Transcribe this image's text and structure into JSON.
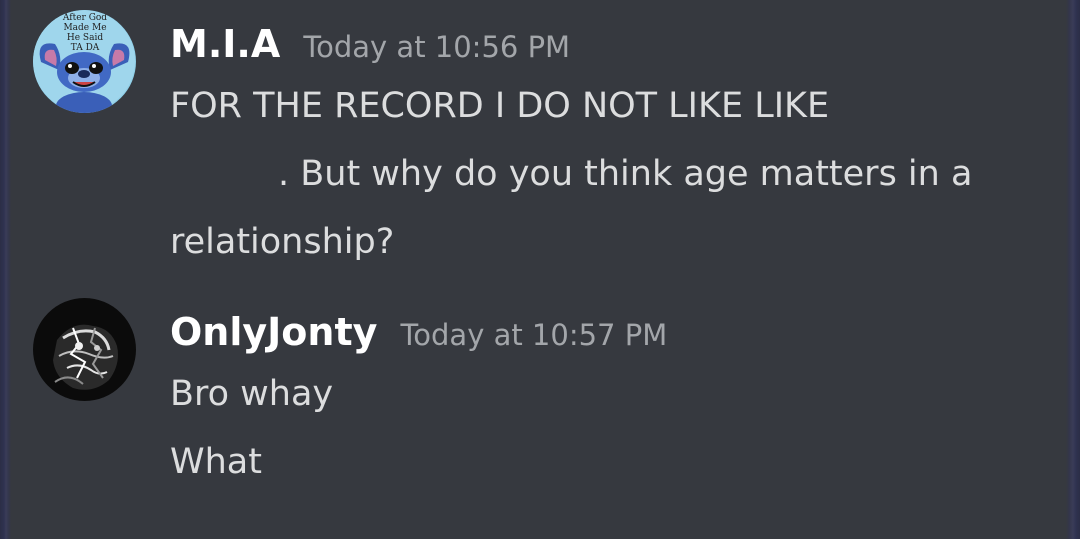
{
  "messages": [
    {
      "username": "M.I.A",
      "timestamp": "Today at 10:56 PM",
      "avatar_text": [
        "After God",
        "Made Me",
        "He Said",
        "TA DA"
      ],
      "lines": [
        "FOR THE RECORD I DO NOT LIKE LIKE",
        ". But why do you think age matters in a",
        "relationship?"
      ]
    },
    {
      "username": "OnlyJonty",
      "timestamp": "Today at 10:57 PM",
      "lines": [
        "Bro whay",
        "What"
      ]
    }
  ],
  "colors": {
    "background": "#36393f",
    "username": "#ffffff",
    "message_text": "#dcddde",
    "timestamp": "#a3a6aa"
  }
}
